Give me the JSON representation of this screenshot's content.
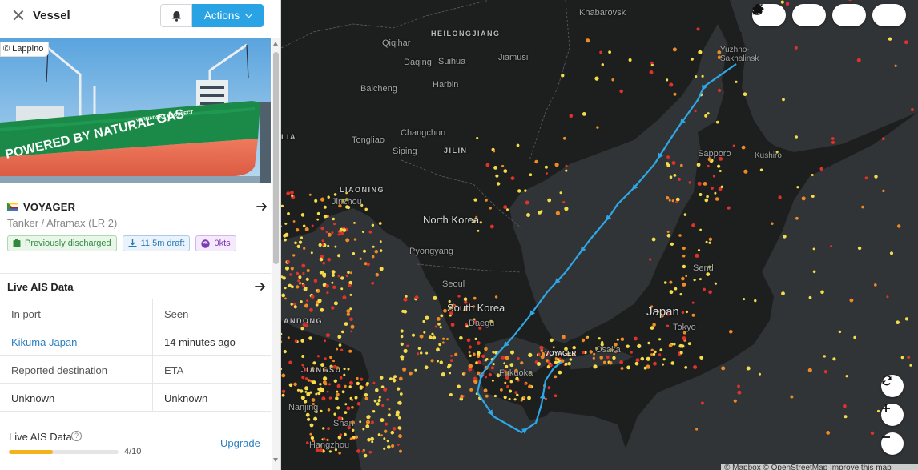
{
  "panel": {
    "title": "Vessel",
    "actions_label": "Actions",
    "photo_credit": "© Lappino",
    "photo_hull_text": "POWERED BY NATURAL GAS",
    "photo_name_text": "VERNADSKY PROSPECT"
  },
  "vessel": {
    "name": "VOYAGER",
    "type": "Tanker / Aframax (LR 2)",
    "badges": [
      {
        "label": "Previously discharged",
        "icon": "storage-icon",
        "color": "#2e8b3d"
      },
      {
        "label": "11.5m draft",
        "icon": "draft-icon",
        "color": "#2a77b4"
      },
      {
        "label": "0kts",
        "icon": "speed-icon",
        "color": "#7b3bb3"
      }
    ]
  },
  "ais": {
    "title": "Live AIS Data",
    "rows": [
      {
        "left": "In port",
        "right": "Seen"
      },
      {
        "left": "Kikuma Japan",
        "right": "14 minutes ago"
      },
      {
        "left": "Reported destination",
        "right": "ETA"
      },
      {
        "left": "Unknown",
        "right": "Unknown"
      }
    ]
  },
  "usage": {
    "title": "Live AIS Data",
    "upgrade_label": "Upgrade",
    "progress_label": "4/10",
    "progress_fraction": 0.4
  },
  "map": {
    "places": {
      "khabarovsk": "Khabarovsk",
      "heilongjiang": "HEILONGJIANG",
      "qiqihar": "Qiqihar",
      "daqing": "Daqing",
      "suihua": "Suihua",
      "jiamusi": "Jiamusi",
      "baicheng": "Baicheng",
      "harbin": "Harbin",
      "changchun": "Changchun",
      "tongliao": "Tongliao",
      "jilin_province": "JILIN",
      "siping": "Siping",
      "liaoning": "LIAONING",
      "jinzhou": "Jinzhou",
      "north_korea": "North Korea",
      "pyongyang": "Pyongyang",
      "seoul": "Seoul",
      "south_korea": "South Korea",
      "daegu": "Daegu",
      "fukuoka": "Fukuoka",
      "japan": "Japan",
      "tokyo": "Tokyo",
      "osaka": "Osaka",
      "sendai": "Send",
      "sapporo": "Sapporo",
      "kushiro": "Kushiro",
      "yuzhno": "Yuzhno-\nSakhalinsk",
      "jiangsu": "JIANGSU",
      "nanjing": "Nanjing",
      "shanghai": "Shan",
      "hangzhou": "Hangzhou",
      "gdong": "ANDONG",
      "lia": "LIA",
      "vessel_marker": "VOYAGER"
    },
    "tools": [
      "ship-icon",
      "anchor-icon",
      "brush-icon",
      "weather-icon"
    ],
    "attribution": "© Mapbox © OpenStreetMap  Improve this map",
    "colors": {
      "land": "#1d1e1e",
      "sea": "#303437",
      "route": "#2fa7e6",
      "dot_yellow": "#f5dd4a",
      "dot_orange": "#f08a24",
      "dot_red": "#e0322b"
    }
  }
}
